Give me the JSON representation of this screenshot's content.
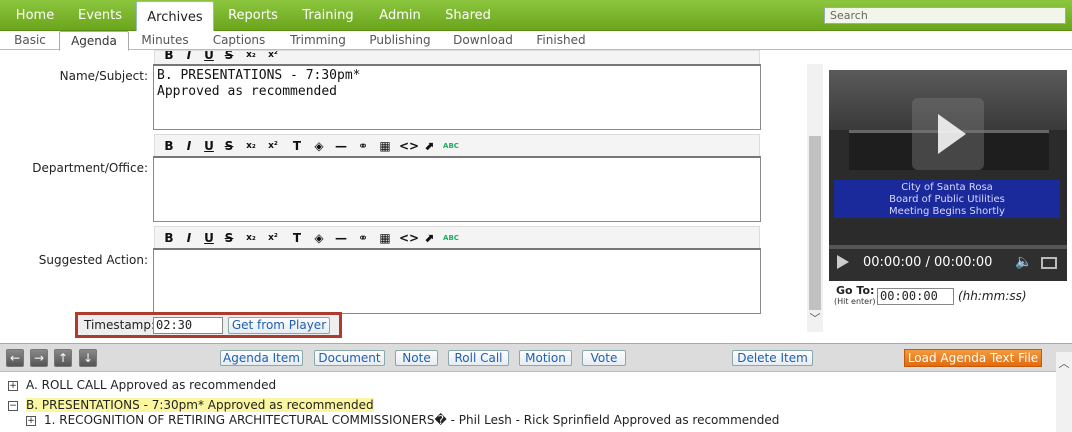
{
  "topnav": {
    "tabs": [
      {
        "label": "Home"
      },
      {
        "label": "Events"
      },
      {
        "label": "Archives"
      },
      {
        "label": "Reports"
      },
      {
        "label": "Training"
      },
      {
        "label": "Admin"
      },
      {
        "label": "Shared"
      }
    ],
    "active": "Archives",
    "search_placeholder": "Search"
  },
  "subnav": {
    "tabs": [
      {
        "label": "Basic"
      },
      {
        "label": "Agenda"
      },
      {
        "label": "Minutes"
      },
      {
        "label": "Captions"
      },
      {
        "label": "Trimming"
      },
      {
        "label": "Publishing"
      },
      {
        "label": "Download"
      },
      {
        "label": "Finished"
      }
    ],
    "active": "Agenda"
  },
  "form": {
    "name_label": "Name/Subject:",
    "name_value": "B. PRESENTATIONS - 7:30pm*\nApproved as recommended",
    "dept_label": "Department/Office:",
    "dept_value": "",
    "action_label": "Suggested Action:",
    "action_value": "",
    "timestamp_label": "Timestamp:",
    "timestamp_value": "02:30",
    "get_from_player": "Get from Player"
  },
  "toolbar": {
    "bold": "B",
    "italic": "I",
    "underline": "U",
    "strike": "S",
    "subscript": "x₂",
    "superscript": "x²",
    "spell": "ABC"
  },
  "video": {
    "banner_line1": "City of Santa Rosa",
    "banner_line2": "Board of Public Utilities",
    "banner_line3": "Meeting Begins Shortly",
    "time": "00:00:00 / 00:00:00",
    "goto_label": "Go To:",
    "goto_sub": "(Hit enter)",
    "goto_value": "00:00:00",
    "goto_hint": "(hh:mm:ss)"
  },
  "actions": {
    "agenda_item": "Agenda Item",
    "document": "Document",
    "note": "Note",
    "roll_call": "Roll Call",
    "motion": "Motion",
    "vote": "Vote",
    "delete_item": "Delete Item",
    "load_text": "Load Agenda Text File"
  },
  "agenda": {
    "rows": [
      {
        "expander": "+",
        "text": "A. ROLL CALL Approved as recommended"
      },
      {
        "expander": "−",
        "text": "B. PRESENTATIONS - 7:30pm* Approved as recommended"
      },
      {
        "expander": "+",
        "text": "1. RECOGNITION OF RETIRING ARCHITECTURAL COMMISSIONERS� - Phil Lesh - Rick Sprinfield Approved as recommended"
      }
    ]
  },
  "colors": {
    "nav_green": "#7ab62c",
    "timestamp_highlight": "#b03a2e",
    "load_button": "#e8781e",
    "selected_row": "#fbf7a0"
  }
}
